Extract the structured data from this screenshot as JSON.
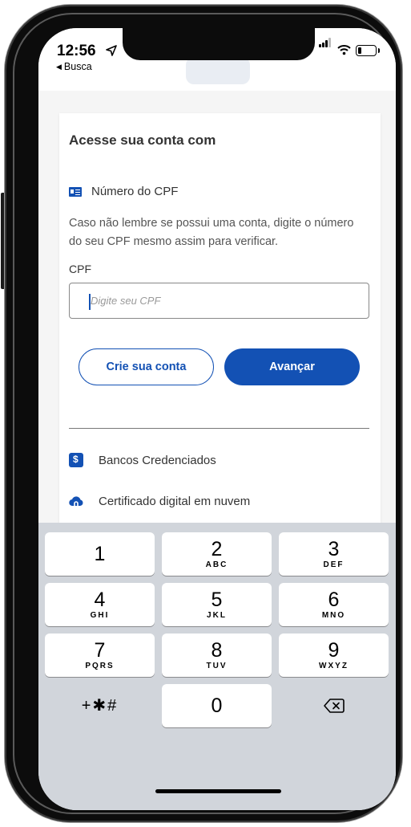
{
  "status_bar": {
    "time": "12:56",
    "back_label": "Busca",
    "icons": [
      "location-arrow-icon",
      "signal-icon",
      "wifi-icon",
      "battery-icon"
    ]
  },
  "card": {
    "title": "Acesse sua conta com",
    "cpf_option_label": "Número do CPF",
    "help_text": "Caso não lembre se possui uma conta, digite o número do seu CPF mesmo assim para verificar.",
    "field_label": "CPF",
    "field_placeholder": "Digite seu CPF",
    "field_value": "",
    "create_button": "Crie sua conta",
    "next_button": "Avançar",
    "options": [
      {
        "label": "Bancos Credenciados",
        "icon": "bank-icon"
      },
      {
        "label": "Certificado digital em nuvem",
        "icon": "cloud-icon"
      }
    ]
  },
  "keypad": {
    "keys": [
      {
        "num": "1",
        "letters": ""
      },
      {
        "num": "2",
        "letters": "ABC"
      },
      {
        "num": "3",
        "letters": "DEF"
      },
      {
        "num": "4",
        "letters": "GHI"
      },
      {
        "num": "5",
        "letters": "JKL"
      },
      {
        "num": "6",
        "letters": "MNO"
      },
      {
        "num": "7",
        "letters": "PQRS"
      },
      {
        "num": "8",
        "letters": "TUV"
      },
      {
        "num": "9",
        "letters": "WXYZ"
      },
      {
        "num": "0",
        "letters": ""
      }
    ],
    "symbols_key": "+✱#",
    "delete_icon": "backspace-icon"
  },
  "colors": {
    "accent": "#1351b4",
    "keyboard_bg": "#d1d5db",
    "page_bg": "#f5f5f5"
  }
}
